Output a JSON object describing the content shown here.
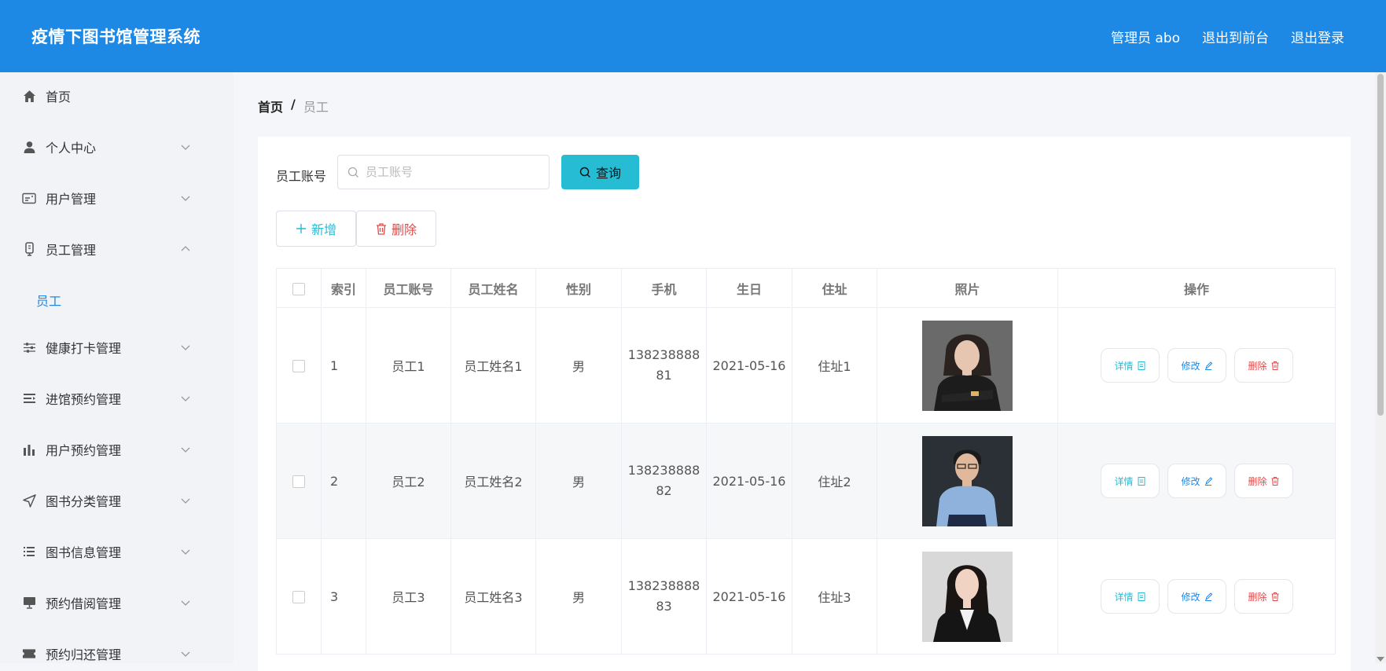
{
  "header": {
    "title": "疫情下图书馆管理系统",
    "admin": "管理员 abo",
    "exit_front": "退出到前台",
    "logout": "退出登录"
  },
  "sidebar": {
    "items": [
      {
        "label": "首页",
        "icon": "home-icon"
      },
      {
        "label": "个人中心",
        "icon": "user-icon"
      },
      {
        "label": "用户管理",
        "icon": "id-card-icon"
      },
      {
        "label": "员工管理",
        "icon": "phone-icon"
      },
      {
        "label": "健康打卡管理",
        "icon": "sliders-icon"
      },
      {
        "label": "进馆预约管理",
        "icon": "list-indent-icon"
      },
      {
        "label": "用户预约管理",
        "icon": "bar-chart-icon"
      },
      {
        "label": "图书分类管理",
        "icon": "send-icon"
      },
      {
        "label": "图书信息管理",
        "icon": "list-icon"
      },
      {
        "label": "预约借阅管理",
        "icon": "monitor-icon"
      },
      {
        "label": "预约归还管理",
        "icon": "ticket-icon"
      }
    ],
    "submenu": {
      "label": "员工"
    }
  },
  "breadcrumb": {
    "home": "首页",
    "separator": "/",
    "current": "员工"
  },
  "search": {
    "label": "员工账号",
    "placeholder": "员工账号",
    "value": "",
    "button": "查询"
  },
  "actions": {
    "add": "新增",
    "delete": "删除"
  },
  "table": {
    "headers": [
      "",
      "索引",
      "员工账号",
      "员工姓名",
      "性别",
      "手机",
      "生日",
      "住址",
      "照片",
      "操作"
    ],
    "rows": [
      {
        "index": "1",
        "account": "员工1",
        "name": "员工姓名1",
        "gender": "男",
        "phone_line1": "138238888",
        "phone_line2": "81",
        "birthday": "2021-05-16",
        "address": "住址1",
        "photo": "woman-black-suit"
      },
      {
        "index": "2",
        "account": "员工2",
        "name": "员工姓名2",
        "gender": "男",
        "phone_line1": "138238888",
        "phone_line2": "82",
        "birthday": "2021-05-16",
        "address": "住址2",
        "photo": "man-blue-shirt"
      },
      {
        "index": "3",
        "account": "员工3",
        "name": "员工姓名3",
        "gender": "男",
        "phone_line1": "138238888",
        "phone_line2": "83",
        "birthday": "2021-05-16",
        "address": "住址3",
        "photo": "woman-dark-blazer"
      }
    ],
    "row_actions": {
      "detail": "详情",
      "edit": "修改",
      "delete": "删除"
    }
  },
  "colors": {
    "header_bg": "#1e88e5",
    "accent_cyan": "#26bcd4",
    "danger": "#e04a4a",
    "sidebar_bg": "#f1f3f6"
  }
}
